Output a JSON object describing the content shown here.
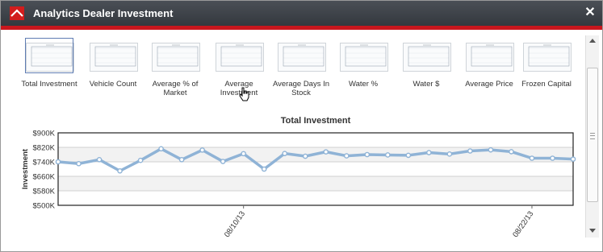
{
  "window": {
    "title": "Analytics Dealer Investment",
    "close_label": "✕",
    "accent_color": "#c8161d"
  },
  "thumbnails": [
    {
      "label": "Total Investment",
      "selected": true
    },
    {
      "label": "Vehicle Count"
    },
    {
      "label": "Average % of Market"
    },
    {
      "label": "Average Investment"
    },
    {
      "label": "Average Days In Stock"
    },
    {
      "label": "Water %"
    },
    {
      "label": "Water $"
    },
    {
      "label": "Average Price"
    },
    {
      "label": "Frozen Capital"
    }
  ],
  "chart_data": {
    "type": "line",
    "title": "Total Investment",
    "ylabel": "Investment",
    "xlabel": "",
    "ylim": [
      500000,
      900000
    ],
    "yticks": [
      {
        "value": 500000,
        "label": "$500K"
      },
      {
        "value": 580000,
        "label": "$580K"
      },
      {
        "value": 660000,
        "label": "$660K"
      },
      {
        "value": 740000,
        "label": "$740K"
      },
      {
        "value": 820000,
        "label": "$820K"
      },
      {
        "value": 900000,
        "label": "$900K"
      }
    ],
    "xticks": [
      {
        "index": 9,
        "label": "08/10/13"
      },
      {
        "index": 23,
        "label": "08/22/13"
      }
    ],
    "series_color": "#8fb3d6",
    "values": [
      740000,
      730000,
      752000,
      690000,
      748000,
      812000,
      752000,
      805000,
      742000,
      785000,
      700000,
      786000,
      771000,
      795000,
      773000,
      780000,
      778000,
      776000,
      791000,
      783000,
      800000,
      806000,
      796000,
      760000,
      760000,
      755000
    ]
  }
}
